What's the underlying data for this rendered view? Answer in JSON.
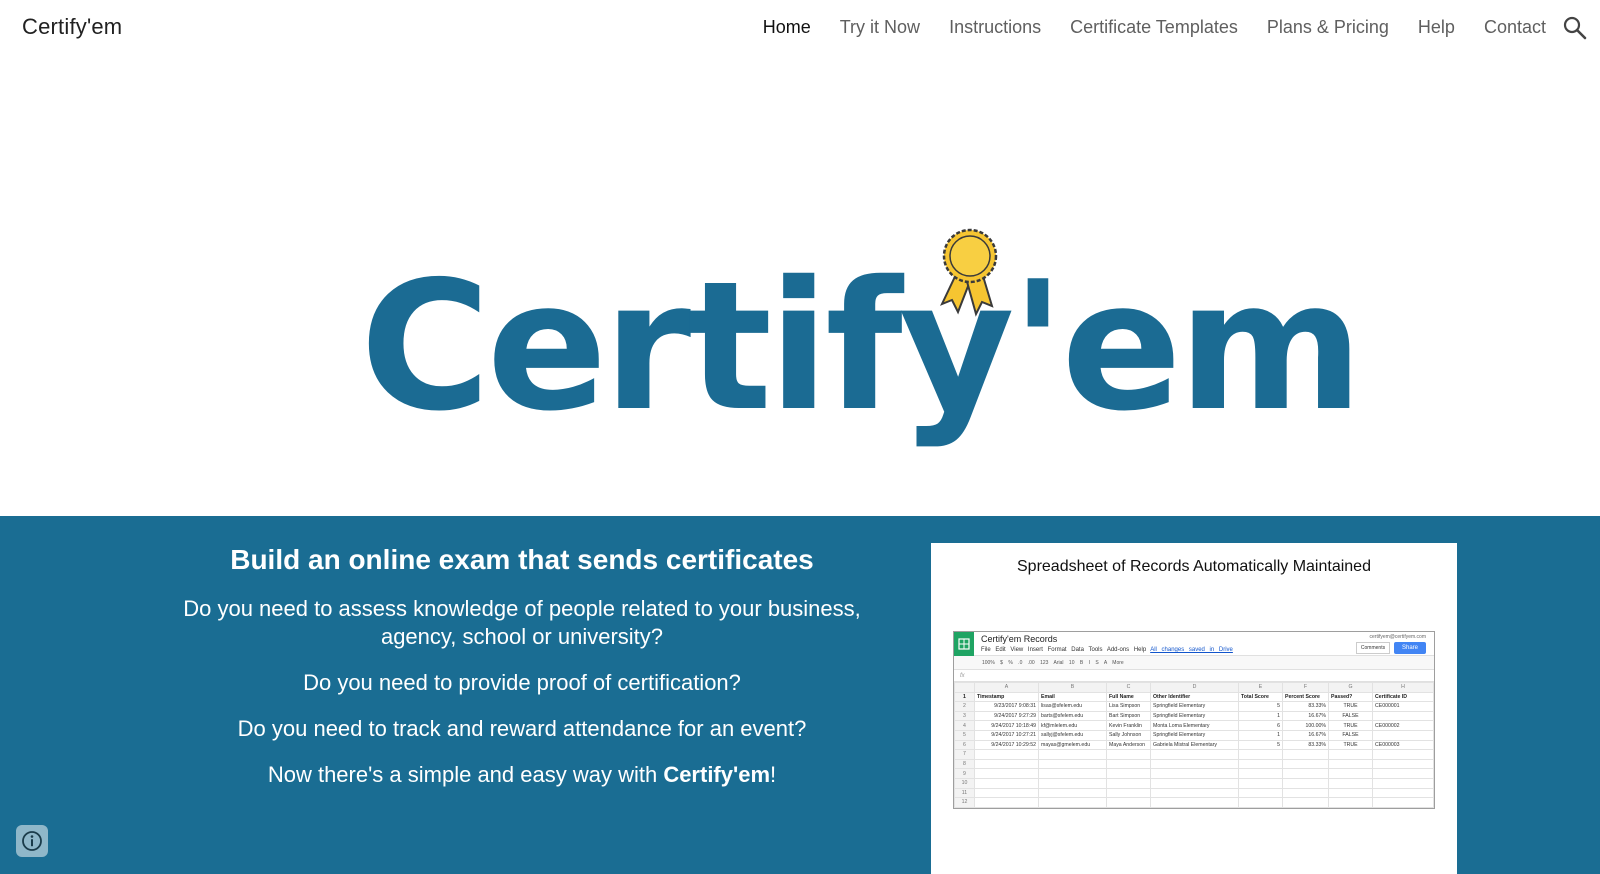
{
  "header": {
    "site_title": "Certify'em",
    "nav": [
      {
        "label": "Home",
        "active": true
      },
      {
        "label": "Try it Now"
      },
      {
        "label": "Instructions"
      },
      {
        "label": "Certificate Templates"
      },
      {
        "label": "Plans & Pricing"
      },
      {
        "label": "Help"
      },
      {
        "label": "Contact"
      }
    ],
    "search_icon": "search-icon"
  },
  "hero": {
    "logo_text": "Certify'em",
    "logo_color": "#1b6b93",
    "ribbon_icon": "award-ribbon-icon",
    "ribbon_color": "#f6c531"
  },
  "band": {
    "background": "#1a6d93",
    "heading": "Build an online exam that sends certificates",
    "questions": [
      "Do you need to assess knowledge of people related to your business, agency, school or university?",
      "Do you need to provide proof of certification?",
      "Do you need to track and reward attendance for an event?"
    ],
    "closing_prefix": "Now there's a simple and easy way with ",
    "closing_brand": "Certify'em",
    "closing_suffix": "!"
  },
  "card": {
    "title": "Spreadsheet of Records Automatically Maintained",
    "sheet": {
      "name": "Certify'em Records",
      "menu": "File Edit View Insert Format Data Tools Add-ons Help",
      "saved": "All changes saved in Drive",
      "email": "certifyem@certifyem.com",
      "comments_label": "Comments",
      "share_label": "Share",
      "toolbar": "100% $ % .0 .00 123 Arial 10 B I S A More",
      "fx": "fx",
      "columns": [
        "A",
        "B",
        "C",
        "D",
        "E",
        "F",
        "G",
        "H"
      ],
      "header_row": [
        "Timestamp",
        "Email",
        "Full Name",
        "Other Identifier",
        "Total Score",
        "Percent Score",
        "Passed?",
        "Certificate ID"
      ],
      "rows": [
        [
          "9/23/2017 9:08:31",
          "lisas@sfelem.edu",
          "Lisa Simpson",
          "Springfield Elementary",
          "5",
          "83.33%",
          "TRUE",
          "CE000001"
        ],
        [
          "9/24/2017 9:27:29",
          "barts@sfelem.edu",
          "Bart Simpson",
          "Springfield Elementary",
          "1",
          "16.67%",
          "FALSE",
          ""
        ],
        [
          "9/24/2017 10:18:49",
          "kf@mlelem.edu",
          "Kevin Franklin",
          "Monta Loma Elementary",
          "6",
          "100.00%",
          "TRUE",
          "CE000002"
        ],
        [
          "9/24/2017 10:27:21",
          "sallyj@sfelem.edu",
          "Sally Johnson",
          "Springfield Elementary",
          "1",
          "16.67%",
          "FALSE",
          ""
        ],
        [
          "9/24/2017 10:29:52",
          "mayas@gmelem.edu",
          "Maya Anderson",
          "Gabriela Mistral Elementary",
          "5",
          "83.33%",
          "TRUE",
          "CE000003"
        ]
      ],
      "row_numbers": [
        "1",
        "2",
        "3",
        "4",
        "5",
        "6",
        "7",
        "8",
        "9",
        "10",
        "11",
        "12"
      ]
    }
  },
  "info_icon": "info-icon"
}
